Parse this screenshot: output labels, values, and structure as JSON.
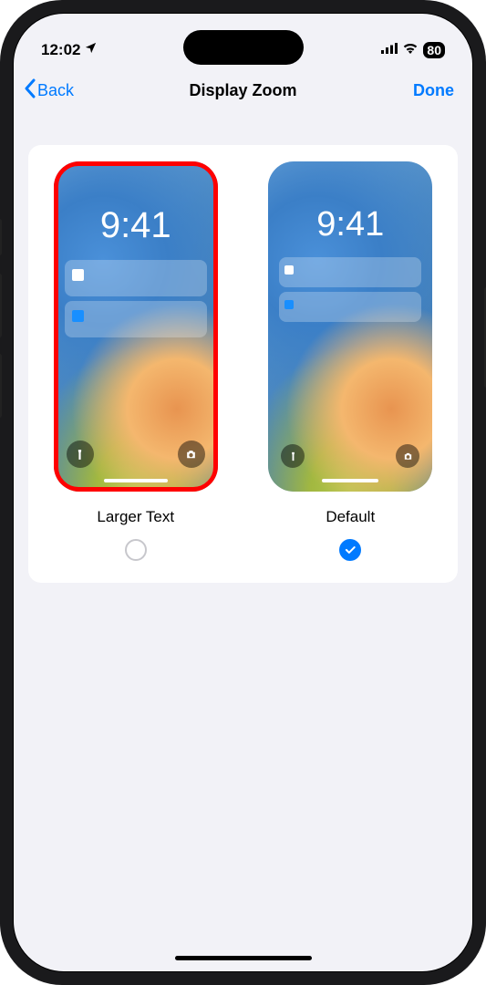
{
  "statusBar": {
    "time": "12:02",
    "batteryLevel": "80"
  },
  "nav": {
    "backLabel": "Back",
    "title": "Display Zoom",
    "doneLabel": "Done"
  },
  "preview": {
    "time": "9:41"
  },
  "options": {
    "larger": {
      "label": "Larger Text",
      "selected": false,
      "highlighted": true
    },
    "default": {
      "label": "Default",
      "selected": true,
      "highlighted": false
    }
  }
}
